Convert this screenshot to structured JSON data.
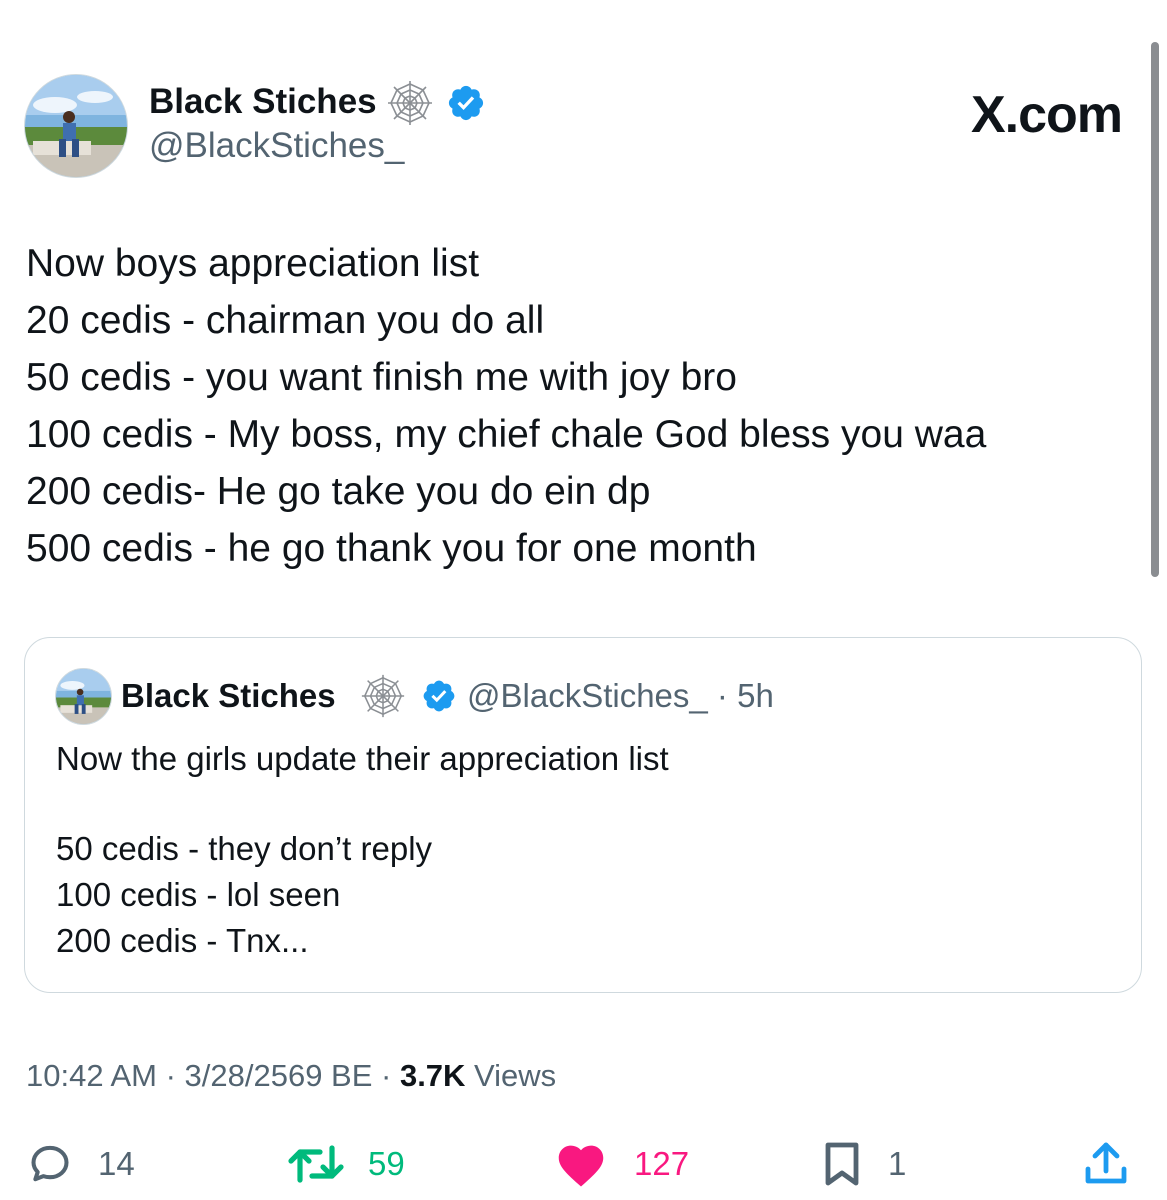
{
  "brand": "X.com",
  "author": {
    "name": "Black Stiches",
    "handle": "@BlackStiches_",
    "badge_icon": "cobweb-emoji",
    "verified_color": "#1d9bf0"
  },
  "tweet": {
    "lines": [
      "Now boys appreciation list",
      "20 cedis - chairman you do all",
      "50 cedis - you want finish me with joy bro",
      "100 cedis - My boss, my chief chale God bless you waa",
      "200 cedis- He go take you do ein dp",
      "500 cedis - he go thank you for one month"
    ]
  },
  "quote": {
    "name": "Black Stiches",
    "handle_time": "@BlackStiches_ · 5h",
    "intro": "Now the girls update their appreciation list",
    "lines": [
      "50 cedis - they don’t reply",
      "100 cedis - lol seen",
      "200 cedis - Tnx..."
    ]
  },
  "meta": {
    "time_date": "10:42 AM · 3/28/2569 BE · ",
    "views_count": "3.7K",
    "views_label": " Views"
  },
  "actions": {
    "replies": "14",
    "retweets": "59",
    "likes": "127",
    "bookmarks": "1"
  },
  "colors": {
    "text": "#0f1419",
    "secondary": "#536471",
    "retweet": "#00ba7c",
    "like": "#f91880",
    "share": "#1d9bf0"
  }
}
